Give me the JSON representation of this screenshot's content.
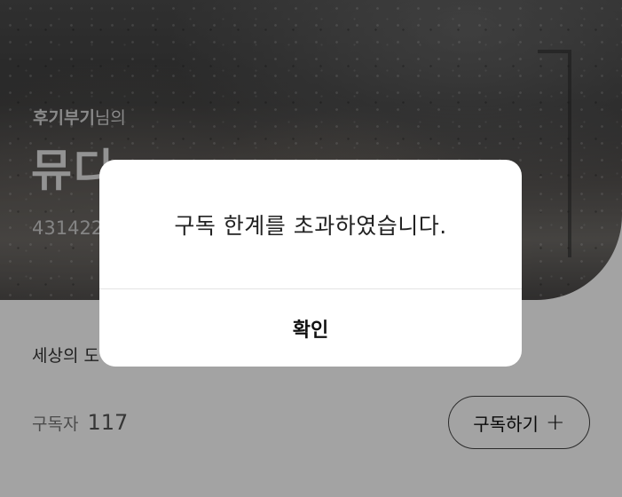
{
  "header": {
    "owner_name": "후기부기",
    "owner_suffix": "님의",
    "title": "뮤디",
    "subtitle_id": "431422"
  },
  "body": {
    "description": "세상의 도",
    "subscriber_label": "구독자",
    "subscriber_count": "117",
    "subscribe_button": {
      "label": "구독하기",
      "icon": "plus-icon"
    }
  },
  "dialog": {
    "message": "구독 한계를 초과하였습니다.",
    "confirm_label": "확인"
  },
  "colors": {
    "overlay": "rgba(0,0,0,0.36)",
    "dialog_bg": "#ffffff"
  }
}
